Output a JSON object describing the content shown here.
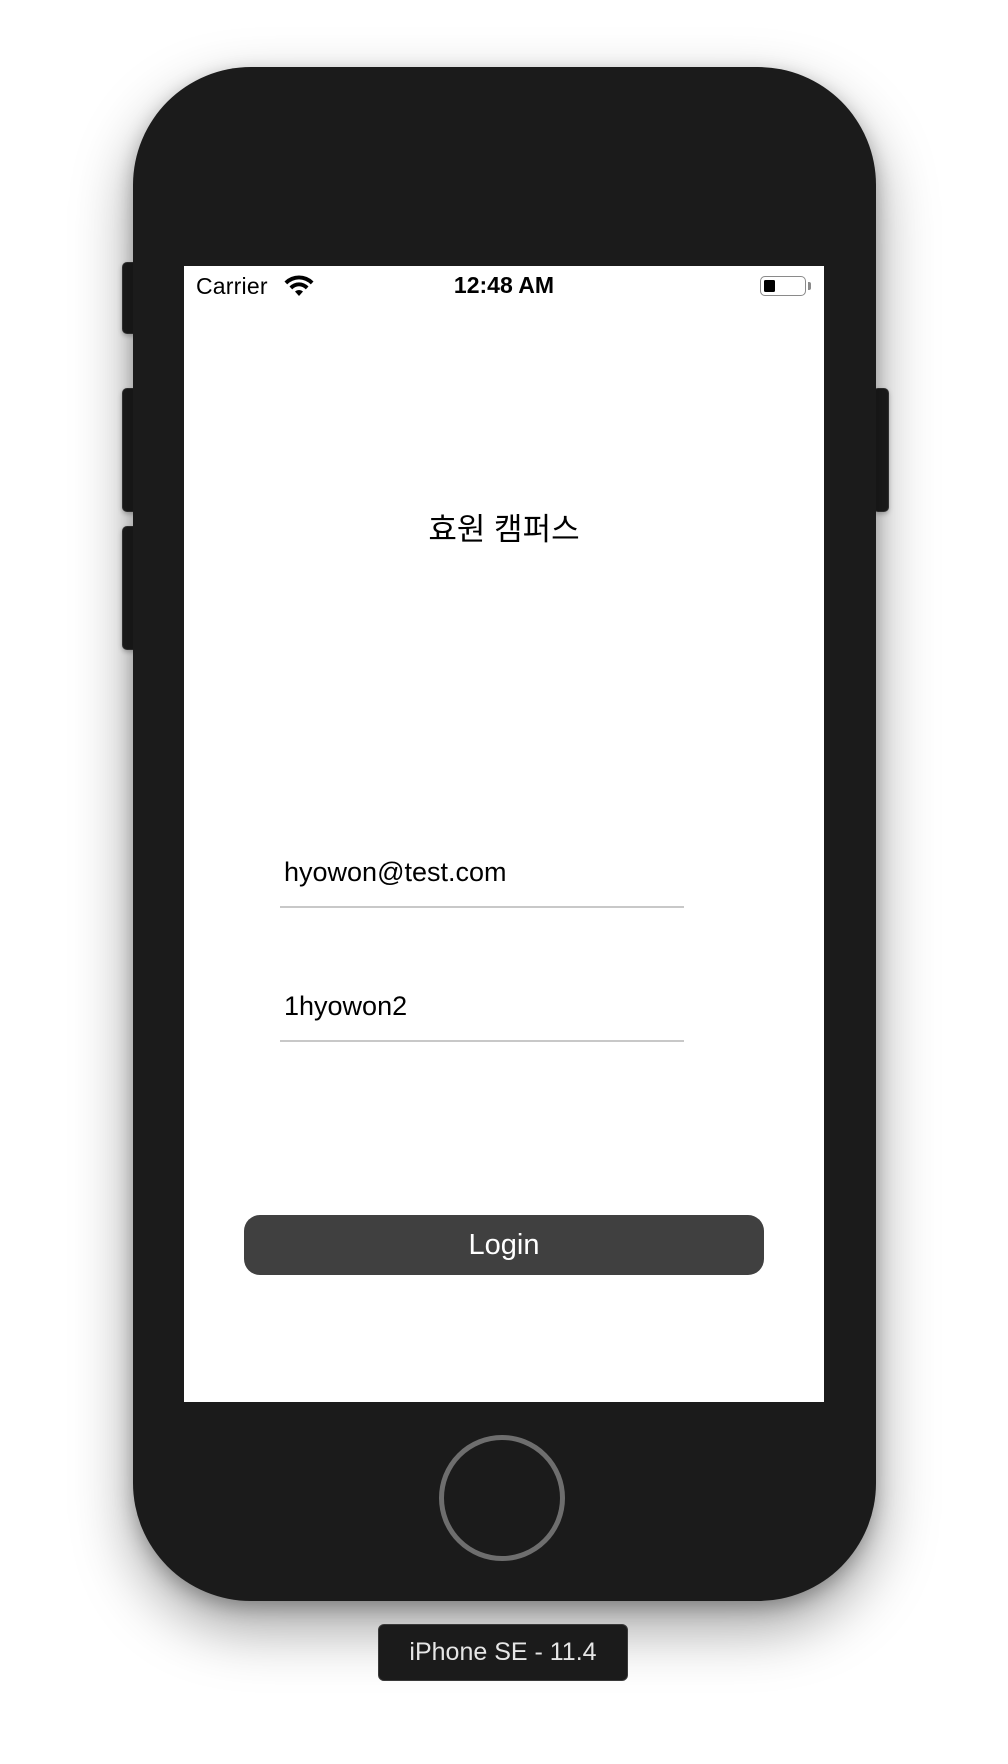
{
  "status_bar": {
    "carrier": "Carrier",
    "time": "12:48 AM",
    "battery_level_percent": 30,
    "wifi_icon": "wifi-icon",
    "battery_icon": "battery-icon"
  },
  "app": {
    "title": "효원 캠퍼스"
  },
  "login_form": {
    "email_value": "hyowon@test.com",
    "password_value": "1hyowon2",
    "login_label": "Login"
  },
  "device": {
    "name_label": "iPhone SE - 11.4"
  },
  "colors": {
    "device_body": "#1b1b1b",
    "button_background": "#404040",
    "field_underline": "#c8c8c8"
  }
}
